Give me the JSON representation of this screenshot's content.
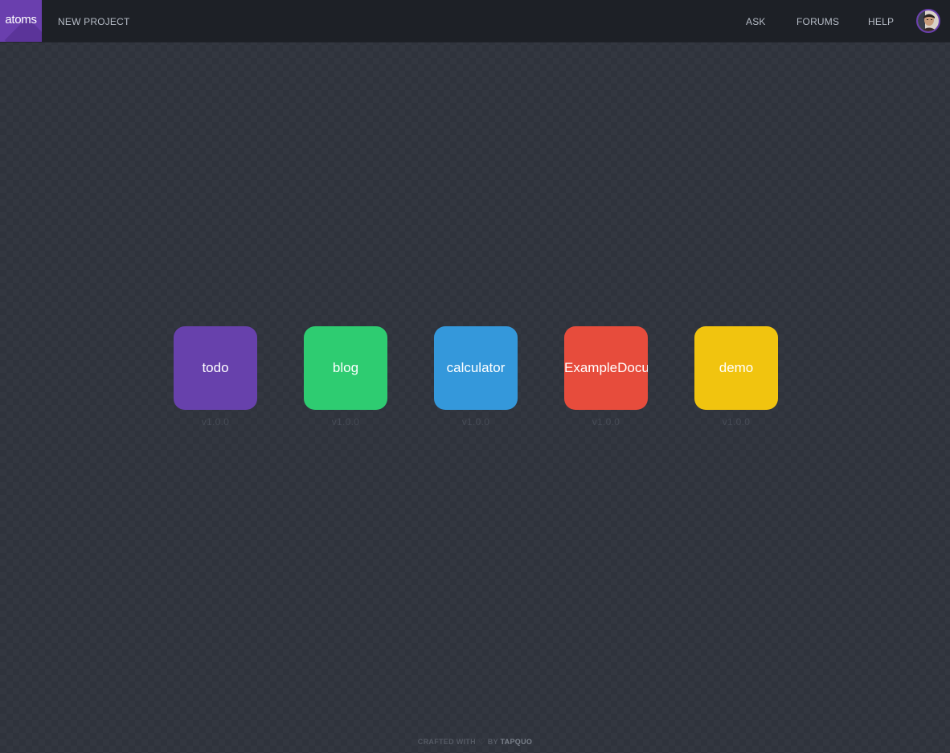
{
  "app": {
    "logo_text": "atoms"
  },
  "topbar": {
    "new_project": "NEW PROJECT",
    "ask": "ASK",
    "forums": "FORUMS",
    "help": "HELP"
  },
  "projects": [
    {
      "name": "todo",
      "version": "v1.0.0",
      "color": "#6741ac"
    },
    {
      "name": "blog",
      "version": "v1.0.0",
      "color": "#2ecc71"
    },
    {
      "name": "calculator",
      "version": "v1.0.0",
      "color": "#3498db"
    },
    {
      "name": "ExampleDocument",
      "version": "v1.0.0",
      "color": "#e74c3c"
    },
    {
      "name": "demo",
      "version": "v1.0.0",
      "color": "#f1c40f"
    }
  ],
  "footer": {
    "crafted": "CRAFTED WITH",
    "heart_icon": "heart-icon",
    "by": "BY",
    "brand": "TAPQUO"
  },
  "colors": {
    "accent": "#6a3fae",
    "background": "#2f333c",
    "topbar": "#1d2026"
  }
}
